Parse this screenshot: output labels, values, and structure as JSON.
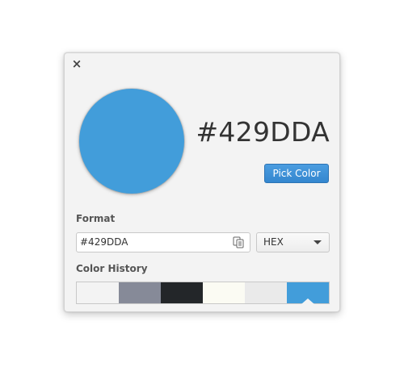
{
  "dialog": {
    "close_glyph": "×",
    "current_color": "#429DDA",
    "hex_title": "#429DDA",
    "pick_button_label": "Pick Color"
  },
  "format": {
    "label": "Format",
    "input_value": "#429DDA",
    "selected_format": "HEX",
    "copy_icon": "copy-icon"
  },
  "history": {
    "label": "Color History",
    "colors": [
      "#f3f3f3",
      "#868a98",
      "#232629",
      "#fbfbf3",
      "#eaeaea",
      "#429dda"
    ],
    "selected_index": 5
  },
  "colors": {
    "accent": "#3d8fd6",
    "background": "#f3f3f3"
  }
}
